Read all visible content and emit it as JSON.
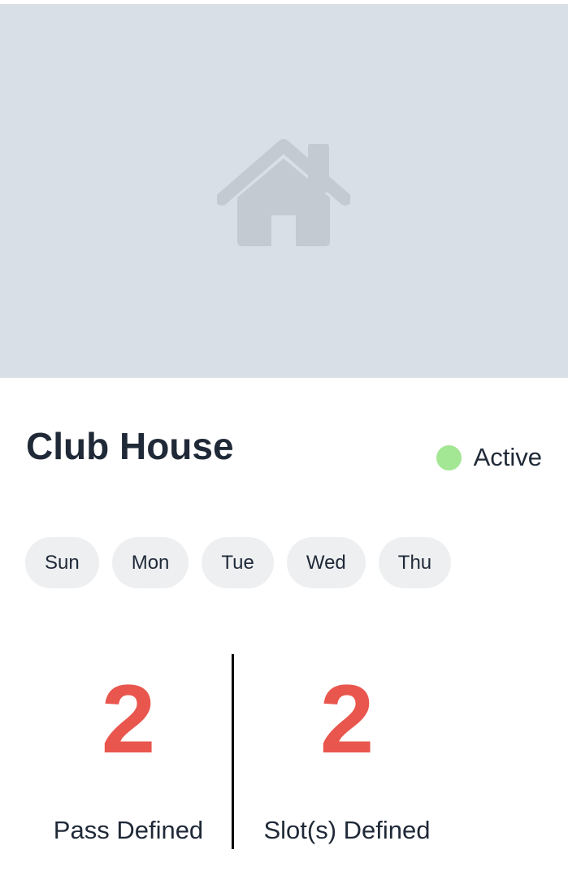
{
  "card": {
    "image_placeholder_icon": "house-icon",
    "title": "Club House",
    "status": {
      "label": "Active",
      "color": "#a3e694"
    },
    "days": [
      "Sun",
      "Mon",
      "Tue",
      "Wed",
      "Thu"
    ],
    "stats": [
      {
        "value": "2",
        "label": "Pass Defined"
      },
      {
        "value": "2",
        "label": "Slot(s) Defined"
      }
    ],
    "accent_color": "#e9564d"
  }
}
